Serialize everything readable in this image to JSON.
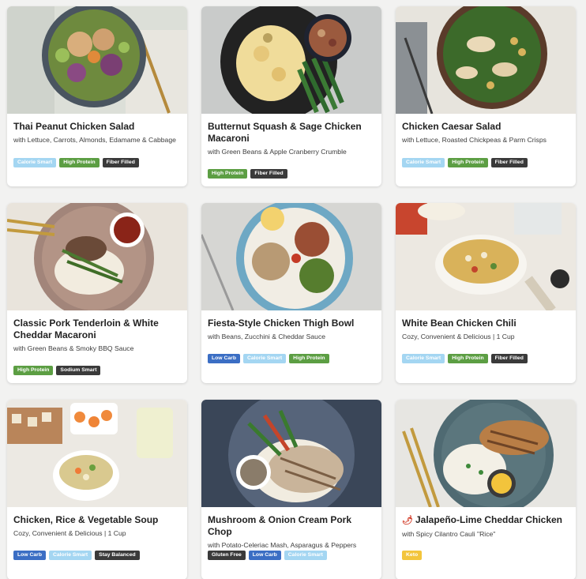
{
  "meals": [
    {
      "title": "Thai Peanut Chicken Salad",
      "subtitle": "with Lettuce, Carrots, Almonds, Edamame & Cabbage",
      "tags": [
        "Calorie Smart",
        "High Protein",
        "Fiber Filled"
      ],
      "icon": "",
      "image": "thai-peanut-salad-bowl-image"
    },
    {
      "title": "Butternut Squash & Sage Chicken Macaroni",
      "subtitle": "with Green Beans & Apple Cranberry Crumble",
      "tags": [
        "High Protein",
        "Fiber Filled"
      ],
      "icon": "",
      "image": "macaroni-plate-image"
    },
    {
      "title": "Chicken Caesar Salad",
      "subtitle": "with Lettuce, Roasted Chickpeas & Parm Crisps",
      "tags": [
        "Calorie Smart",
        "High Protein",
        "Fiber Filled"
      ],
      "icon": "",
      "image": "caesar-salad-bowl-image"
    },
    {
      "title": "Classic Pork Tenderloin & White Cheddar Macaroni",
      "subtitle": "with Green Beans & Smoky BBQ Sauce",
      "tags": [
        "High Protein",
        "Sodium Smart"
      ],
      "icon": "",
      "image": "pork-tenderloin-plate-image"
    },
    {
      "title": "Fiesta-Style Chicken Thigh Bowl",
      "subtitle": "with Beans, Zucchini & Cheddar Sauce",
      "tags": [
        "Low Carb",
        "Calorie Smart",
        "High Protein"
      ],
      "icon": "",
      "image": "fiesta-bowl-image"
    },
    {
      "title": "White Bean Chicken Chili",
      "subtitle": "Cozy, Convenient & Delicious | 1 Cup",
      "tags": [
        "Calorie Smart",
        "High Protein",
        "Fiber Filled"
      ],
      "icon": "",
      "image": "white-bean-chili-bowl-image"
    },
    {
      "title": "Chicken, Rice & Vegetable Soup",
      "subtitle": "Cozy, Convenient & Delicious | 1 Cup",
      "tags": [
        "Low Carb",
        "Calorie Smart",
        "Stay Balanced"
      ],
      "icon": "",
      "image": "vegetable-soup-bowl-image"
    },
    {
      "title": "Mushroom & Onion Cream Pork Chop",
      "subtitle": "with Potato-Celeriac Mash, Asparagus & Peppers",
      "tags": [
        "Gluten Free",
        "Low Carb",
        "Calorie Smart"
      ],
      "icon": "",
      "image": "pork-chop-plate-image"
    },
    {
      "title": "Jalapeño-Lime Cheddar Chicken",
      "subtitle": "with Spicy Cilantro Cauli \"Rice\"",
      "tags": [
        "Keto"
      ],
      "icon": "chili-pepper-icon",
      "image": "jalapeno-chicken-plate-image"
    }
  ],
  "tag_colors": {
    "Calorie Smart": "#a4d6f2",
    "High Protein": "#5c9e43",
    "Fiber Filled": "#3a3a3a",
    "Low Carb": "#3b6ec4",
    "Sodium Smart": "#3a3a3a",
    "Stay Balanced": "#3a3a3a",
    "Gluten Free": "#3a3a3a",
    "Keto": "#f3c53c"
  }
}
